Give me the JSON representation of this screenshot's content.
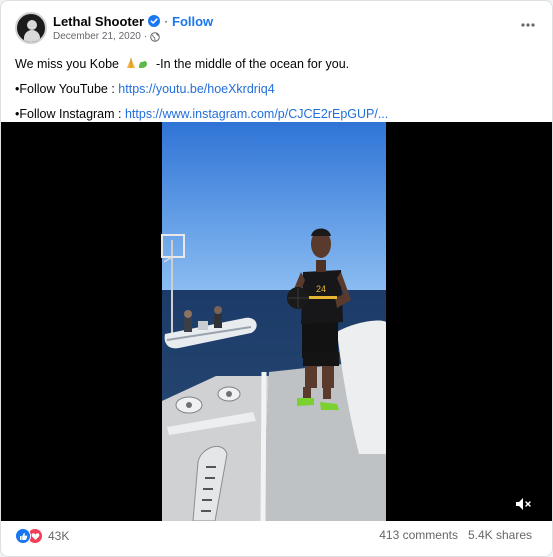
{
  "post": {
    "page_name": "Lethal Shooter",
    "follow_label": "Follow",
    "date": "December 21, 2020",
    "date_sep": "·",
    "name_sep": "·",
    "audience_icon": "globe-icon",
    "more_icon": "more-options-icon",
    "text": {
      "line1_a": "We miss you Kobe",
      "line1_b": "-In the middle of the ocean for you.",
      "youtube_label": "•Follow YouTube : ",
      "youtube_link": "https://youtu.be/hoeXkrdriq4",
      "instagram_label": "•Follow Instagram : ",
      "instagram_link": "https://www.instagram.com/p/CJCE2rEpGUP/..."
    }
  },
  "video": {
    "mute_icon": "volume-muted-icon",
    "jersey_number": "24"
  },
  "footer": {
    "reaction_count": "43K",
    "comments": "413 comments",
    "shares": "5.4K shares"
  },
  "colors": {
    "link": "#216fdb",
    "follow": "#1877f2",
    "like": "#1877f2",
    "love": "#f33e58",
    "sky": "#3f87e6",
    "sea": "#1d3f70"
  }
}
